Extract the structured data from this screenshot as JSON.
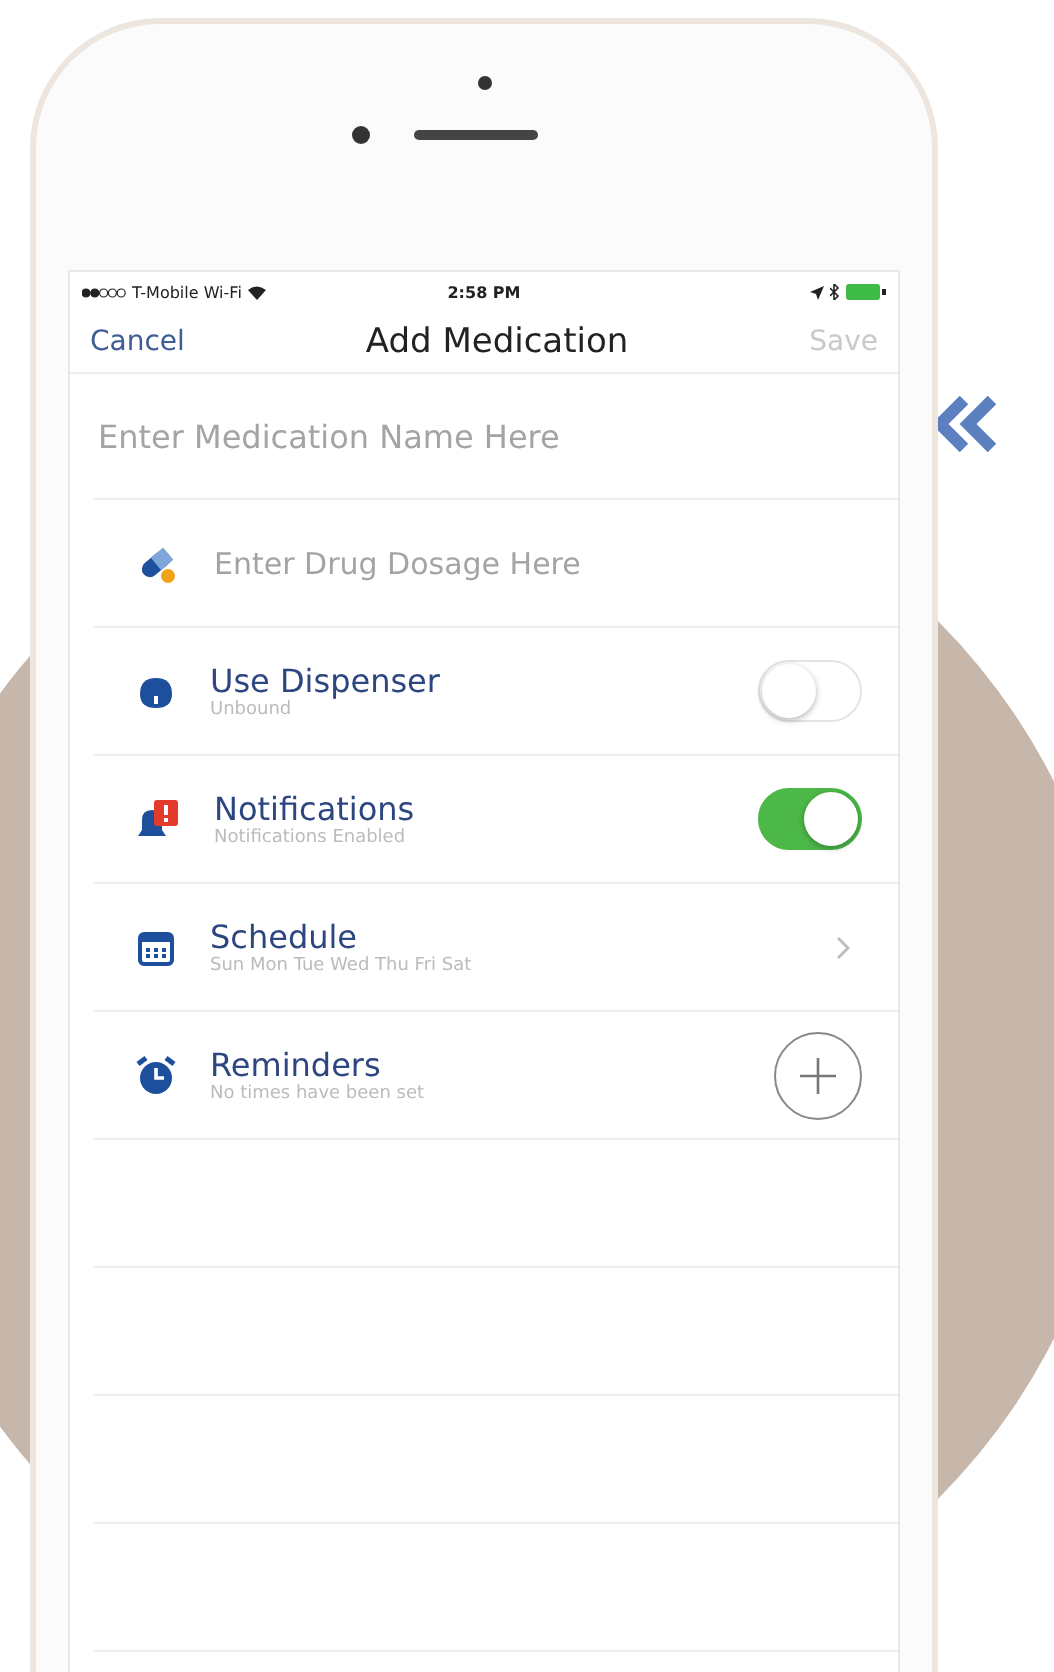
{
  "status_bar": {
    "carrier": "T-Mobile Wi-Fi",
    "time": "2:58 PM"
  },
  "nav": {
    "cancel": "Cancel",
    "title": "Add Medication",
    "save": "Save",
    "save_disabled": true
  },
  "name_field": {
    "placeholder": "Enter Medication Name Here"
  },
  "dosage_field": {
    "placeholder": "Enter Drug Dosage Here"
  },
  "rows": [
    {
      "kind": "toggle",
      "title": "Use Dispenser",
      "subtitle": "Unbound",
      "on": false
    },
    {
      "kind": "toggle",
      "title": "Notifications",
      "subtitle": "Notifications Enabled",
      "on": true
    },
    {
      "kind": "chevron",
      "title": "Schedule",
      "subtitle": "Sun Mon Tue Wed Thu Fri Sat"
    },
    {
      "kind": "add",
      "title": "Reminders",
      "subtitle": "No times have been set"
    }
  ]
}
